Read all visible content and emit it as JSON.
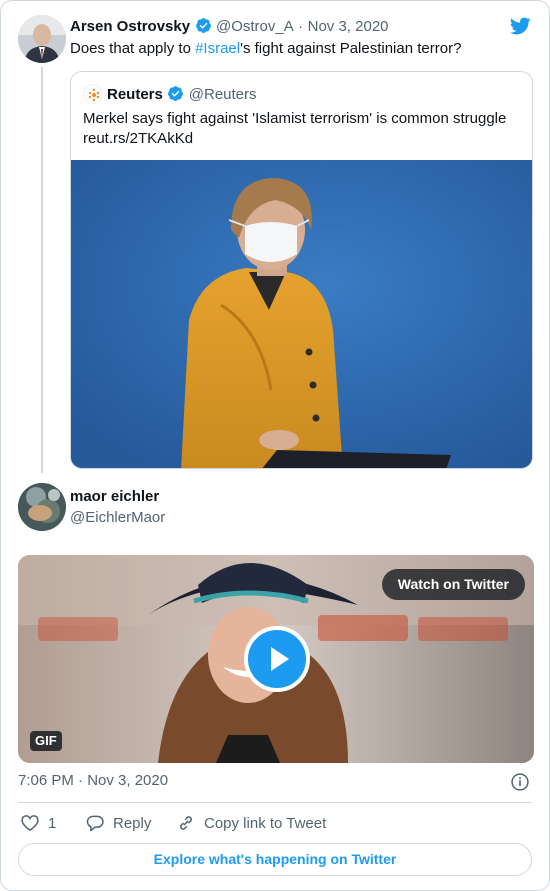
{
  "parent_tweet": {
    "author_name": "Arsen Ostrovsky",
    "author_handle": "@Ostrov_A",
    "separator": "·",
    "date": "Nov 3, 2020",
    "text_before": "Does that apply to ",
    "hashtag": "#Israel",
    "text_after": "'s fight against Palestinian terror?"
  },
  "quoted_tweet": {
    "author_name": "Reuters",
    "author_handle": "@Reuters",
    "text": "Merkel says fight against 'Islamist terrorism' is common struggle",
    "link": "reut.rs/2TKAkKd"
  },
  "reply_tweet": {
    "author_name": "maor eichler",
    "author_handle": "@EichlerMaor",
    "media": {
      "watch_label": "Watch on Twitter",
      "gif_badge": "GIF"
    },
    "timestamp": "7:06 PM · Nov 3, 2020"
  },
  "actions": {
    "like_count": "1",
    "reply_label": "Reply",
    "copy_link_label": "Copy link to Tweet"
  },
  "footer": {
    "explore_label": "Explore what's happening on Twitter"
  },
  "colors": {
    "accent": "#1d9bf0",
    "muted": "#536471",
    "border": "#cfd9de"
  },
  "icons": [
    "twitter-bird-icon",
    "verified-badge-icon",
    "play-icon",
    "info-icon",
    "heart-icon",
    "reply-bubble-icon",
    "link-icon"
  ]
}
